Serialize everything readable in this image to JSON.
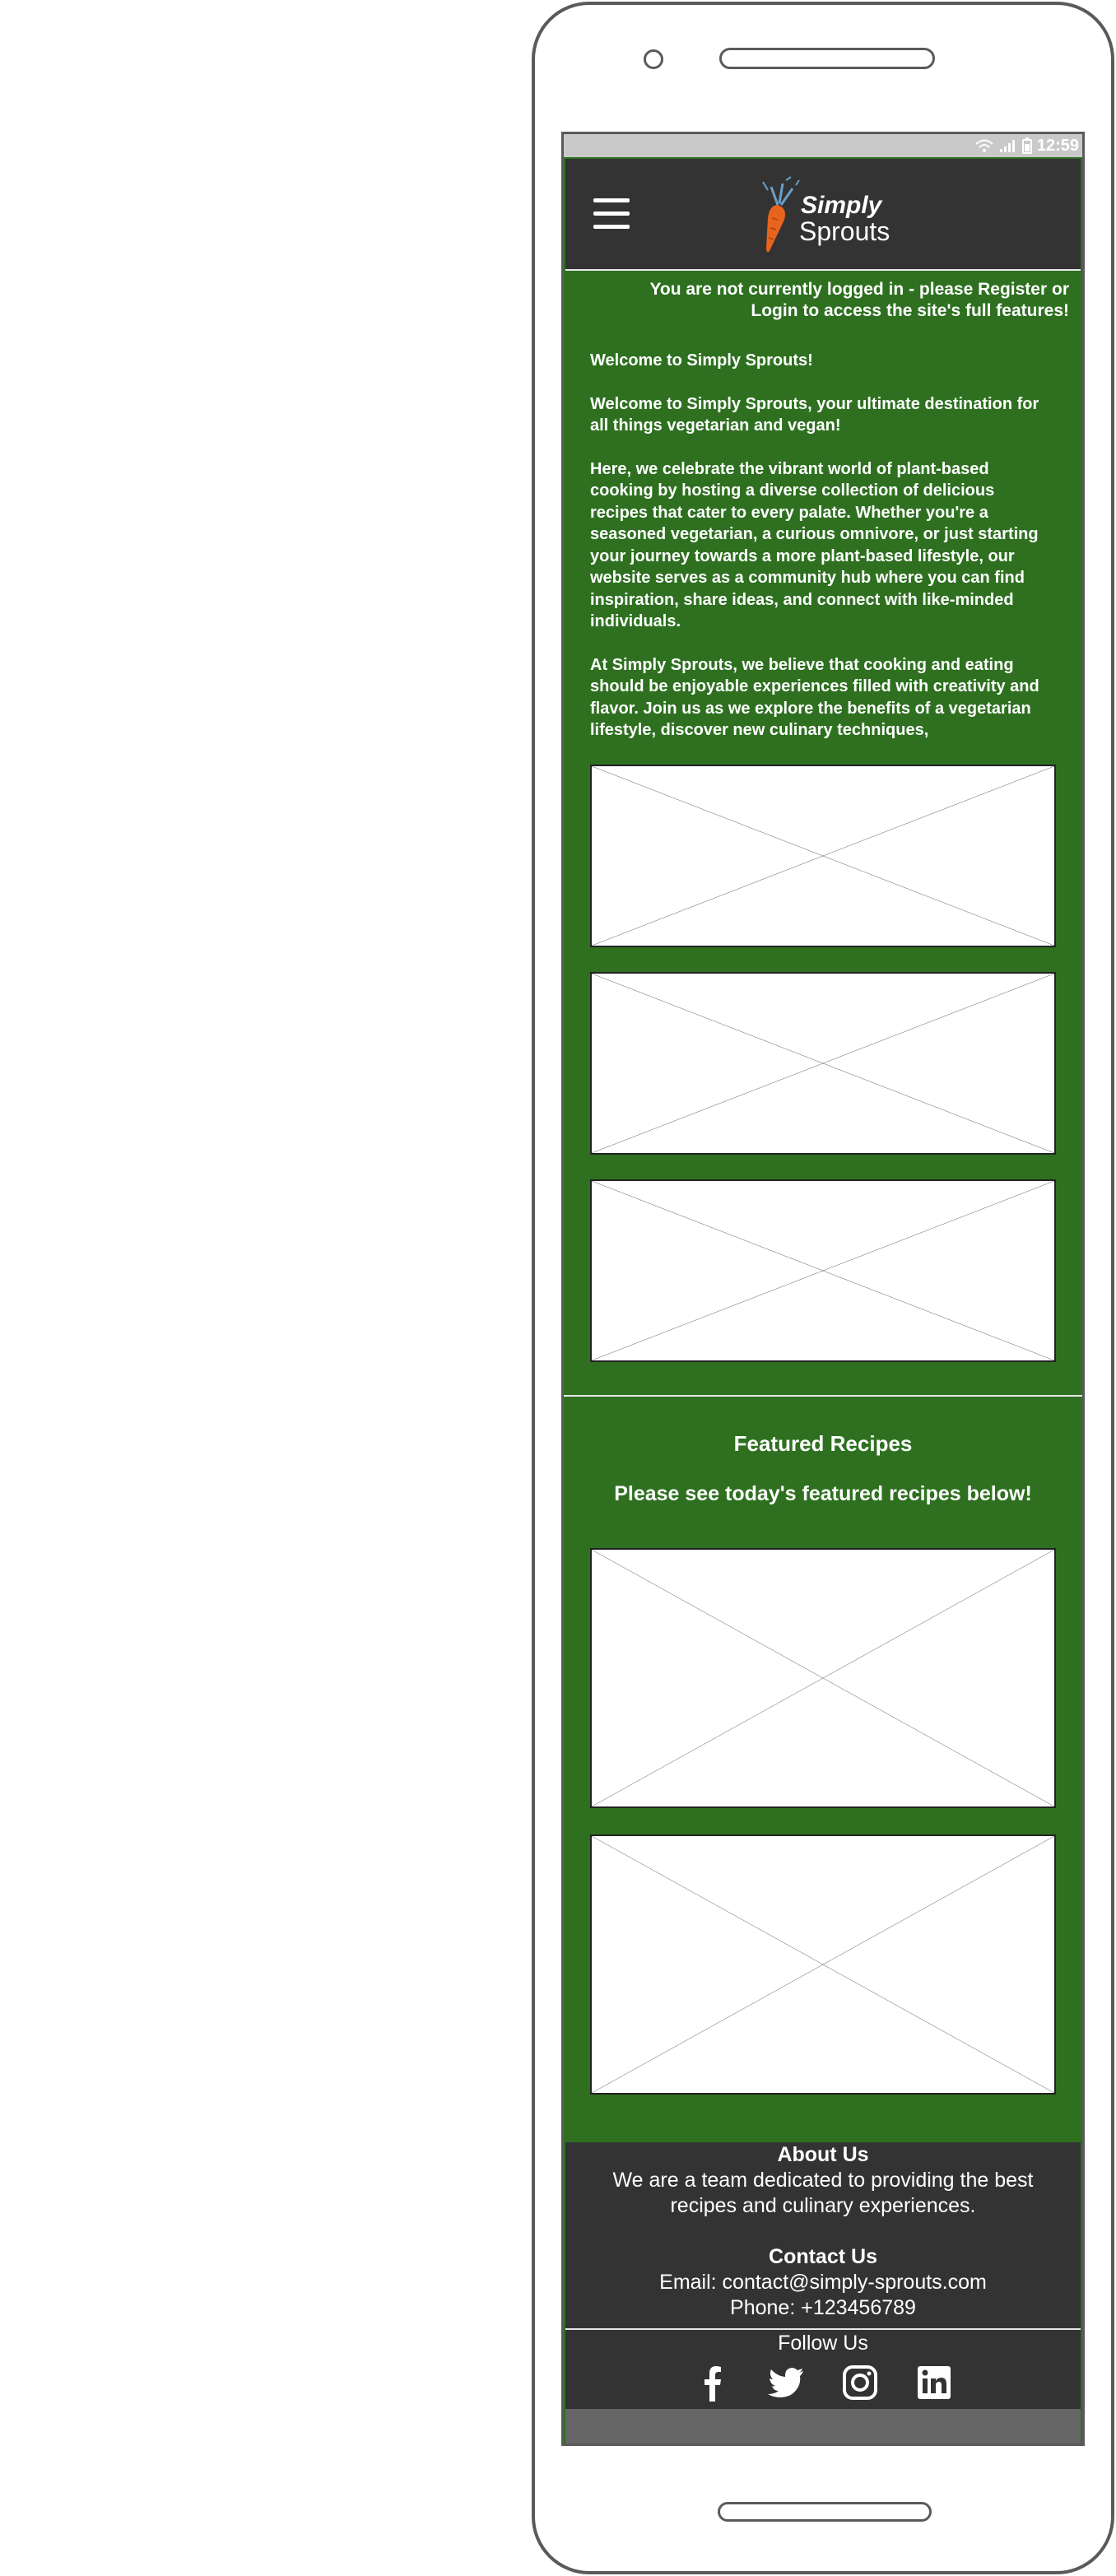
{
  "status_bar": {
    "time": "12:59",
    "icons": [
      "wifi-icon",
      "signal-icon",
      "battery-icon"
    ]
  },
  "header": {
    "menu_icon": "hamburger-icon",
    "logo_line1": "Simply",
    "logo_line2": "Sprouts"
  },
  "notice": {
    "text": "You are not currently logged in - please Register or Login to access the site's full features!"
  },
  "intro": {
    "heading": "Welcome to Simply Sprouts!",
    "paragraphs": [
      "Welcome to Simply Sprouts, your ultimate destination for all things vegetarian and vegan!",
      "Here, we celebrate the vibrant world of plant-based cooking by hosting a diverse collection of delicious recipes that cater to every palate. Whether you're a seasoned vegetarian, a curious omnivore, or just starting your journey towards a more plant-based lifestyle, our website serves as a community hub where you can find inspiration, share ideas, and connect with like-minded individuals.",
      "At Simply Sprouts, we believe that cooking and eating should be enjoyable experiences filled with creativity and flavor. Join us as we explore the benefits of a vegetarian lifestyle, discover new culinary techniques,"
    ]
  },
  "featured": {
    "title": "Featured Recipes",
    "subtitle": "Please see today's featured recipes below!"
  },
  "footer": {
    "about_title": "About Us",
    "about_text": "We are a team dedicated to providing the best recipes and culinary experiences.",
    "contact_title": "Contact Us",
    "email": "Email: contact@simply-sprouts.com",
    "phone": "Phone: +123456789",
    "follow_title": "Follow Us",
    "social_icons": [
      "facebook-icon",
      "twitter-icon",
      "instagram-icon",
      "linkedin-icon"
    ]
  },
  "colors": {
    "page_green": "#2e7020",
    "header_dark": "#333333",
    "carrot_orange": "#e8641e",
    "status_bar": "#c9c9c9"
  }
}
